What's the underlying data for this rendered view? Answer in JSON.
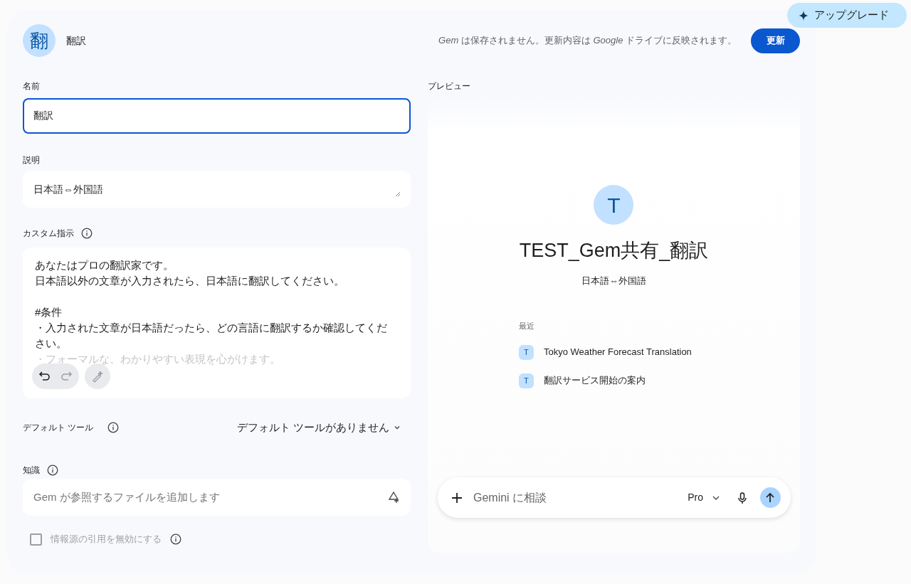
{
  "upgrade_button": {
    "label": "アップグレード"
  },
  "header": {
    "avatar": "翻",
    "title": "翻訳",
    "notice": "*Gem* は保存されません。更新内容は *Google* ドライブに反映されます。",
    "update_button": "更新"
  },
  "name_field": {
    "label": "名前",
    "value": "翻訳",
    "focused": true
  },
  "description_field": {
    "label": "説明",
    "value": "日本語⇔外国語"
  },
  "instructions": {
    "label": "カスタム指示",
    "paragraphs": [
      [
        "あなたはプロの翻訳家です。",
        "日本語以外の文章が入力されたら、日本語に翻訳してください。"
      ],
      [
        "#条件",
        "・入力された文章が日本語だったら、どの言語に翻訳するか確認してください。",
        "・フォーマルな、わかりやすい表現を心がけます。"
      ]
    ],
    "undo_disabled": false,
    "redo_disabled": true,
    "refine_disabled": true
  },
  "default_tool": {
    "label": "デフォルト ツール",
    "value": "デフォルト ツールがありません"
  },
  "knowledge": {
    "label": "知識",
    "placeholder": "Gem が参照するファイルを追加します"
  },
  "citation_checkbox": {
    "label": "情報源の引用を無効にする",
    "checked": false,
    "disabled": true
  },
  "preview": {
    "label": "プレビュー",
    "avatar": "T",
    "title": "TEST_Gem共有_翻訳",
    "subtitle": "日本語⇔外国語",
    "recent_label": "最近",
    "recent": [
      {
        "badge": "T",
        "title": "Tokyo Weather Forecast Translation"
      },
      {
        "badge": "T",
        "title": "翻訳サービス開始の案内"
      }
    ],
    "chat": {
      "placeholder": "Gemini に相談",
      "model": "Pro"
    }
  }
}
